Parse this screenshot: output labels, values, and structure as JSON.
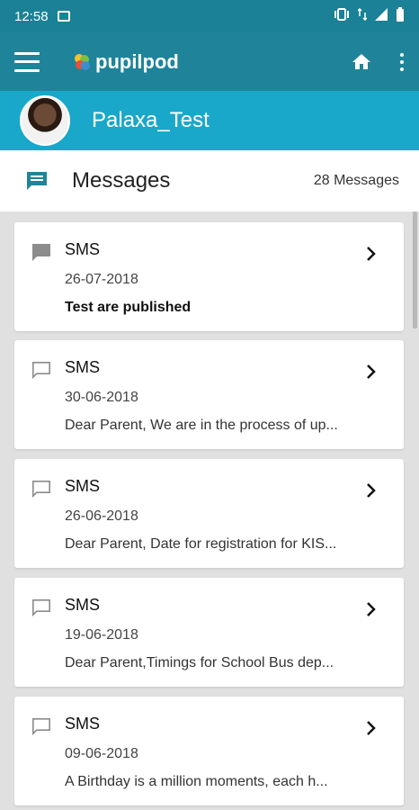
{
  "status": {
    "time": "12:58"
  },
  "app": {
    "brand": "pupilpod"
  },
  "profile": {
    "name": "Palaxa_Test"
  },
  "header": {
    "title": "Messages",
    "count": "28 Messages"
  },
  "messages": [
    {
      "type": "SMS",
      "date": "26-07-2018",
      "text": "Test are published",
      "unread": true
    },
    {
      "type": "SMS",
      "date": "30-06-2018",
      "text": "Dear Parent, We are in the process of up...",
      "unread": false
    },
    {
      "type": "SMS",
      "date": "26-06-2018",
      "text": "Dear Parent, Date for registration for KIS...",
      "unread": false
    },
    {
      "type": "SMS",
      "date": "19-06-2018",
      "text": "Dear Parent,Timings for School Bus dep...",
      "unread": false
    },
    {
      "type": "SMS",
      "date": "09-06-2018",
      "text": "A Birthday is a million moments, each h...",
      "unread": false
    }
  ],
  "colors": {
    "status_bar": "#1b8197",
    "app_bar": "#1f849a",
    "profile_bar": "#19a8c9",
    "accent": "#1f849a"
  }
}
